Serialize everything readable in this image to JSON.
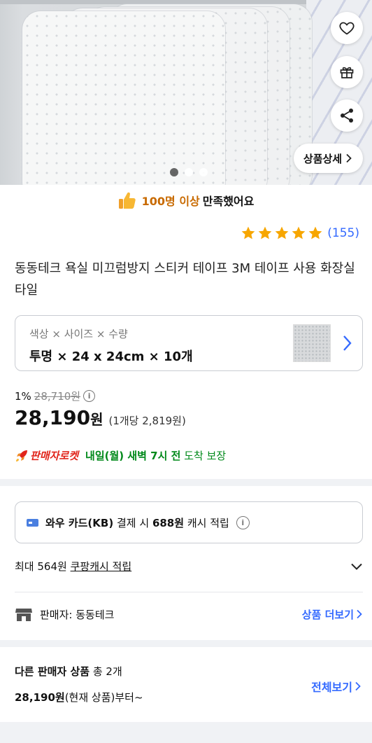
{
  "hero": {
    "buttons": {
      "detail_label": "상품상세"
    },
    "pager": {
      "count": 3,
      "active": 1
    }
  },
  "satisfaction": {
    "highlight": "100명 이상",
    "rest": "만족했어요"
  },
  "rating": {
    "stars": 5,
    "count": "(155)"
  },
  "product": {
    "title": "동동테크 욕실 미끄럼방지 스티커 테이프 3M 테이프 사용 화장실 타일"
  },
  "option": {
    "label": "색상 × 사이즈 × 수량",
    "value": "투명 × 24 x 24cm × 10개"
  },
  "price": {
    "discount": "1%",
    "original": "28,710원",
    "amount": "28,190",
    "currency": "원",
    "unit_price": "(1개당 2,819원)"
  },
  "delivery": {
    "badge": "판매자로켓",
    "highlight": "내일(월) 새벽 7시 전",
    "rest": "도착 보장"
  },
  "card_offer": {
    "card_name": "와우 카드(KB)",
    "text1": "결제 시",
    "amount": "688원",
    "text2": "캐시 적립"
  },
  "cash": {
    "prefix": "최대 564원",
    "link": "쿠팡캐시 적립"
  },
  "seller": {
    "label": "판매자: 동동테크",
    "more": "상품 더보기"
  },
  "others": {
    "title": "다른 판매자 상품",
    "count": "총 2개",
    "price": "28,190원",
    "price_suffix": "(현재 상품)부터~",
    "view_all": "전체보기"
  },
  "colors": {
    "accent_blue": "#346aff",
    "star": "#f7a600",
    "rocket_red": "#e1251b",
    "delivery_green": "#00891a"
  }
}
